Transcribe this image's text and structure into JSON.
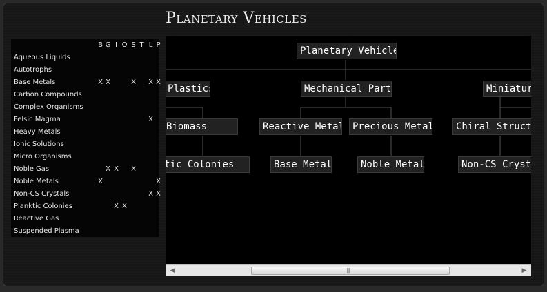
{
  "window": {
    "title": "Planetary Vehicles"
  },
  "matrix": {
    "header": [
      "B",
      "G",
      "I",
      "O",
      "S",
      "T",
      "L",
      "P"
    ],
    "rows": [
      {
        "label": "Aqueous Liquids",
        "cells": [
          "",
          "",
          "",
          "",
          "",
          "",
          "",
          ""
        ]
      },
      {
        "label": "Autotrophs",
        "cells": [
          "",
          "",
          "",
          "",
          "",
          "",
          "",
          ""
        ]
      },
      {
        "label": "Base Metals",
        "cells": [
          "X",
          "X",
          "",
          "",
          "X",
          "",
          "X",
          "X"
        ]
      },
      {
        "label": "Carbon Compounds",
        "cells": [
          "",
          "",
          "",
          "",
          "",
          "",
          "",
          ""
        ]
      },
      {
        "label": "Complex Organisms",
        "cells": [
          "",
          "",
          "",
          "",
          "",
          "",
          "",
          ""
        ]
      },
      {
        "label": "Felsic Magma",
        "cells": [
          "",
          "",
          "",
          "",
          "",
          "",
          "X",
          ""
        ]
      },
      {
        "label": "Heavy Metals",
        "cells": [
          "",
          "",
          "",
          "",
          "",
          "",
          "",
          ""
        ]
      },
      {
        "label": "Ionic Solutions",
        "cells": [
          "",
          "",
          "",
          "",
          "",
          "",
          "",
          ""
        ]
      },
      {
        "label": "Micro Organisms",
        "cells": [
          "",
          "",
          "",
          "",
          "",
          "",
          "",
          ""
        ]
      },
      {
        "label": "Noble Gas",
        "cells": [
          "",
          "X",
          "X",
          "",
          "X",
          "",
          "",
          ""
        ]
      },
      {
        "label": "Noble Metals",
        "cells": [
          "X",
          "",
          "",
          "",
          "",
          "",
          "",
          "X"
        ]
      },
      {
        "label": "Non-CS Crystals",
        "cells": [
          "",
          "",
          "",
          "",
          "",
          "",
          "X",
          "X"
        ]
      },
      {
        "label": "Planktic Colonies",
        "cells": [
          "",
          "",
          "X",
          "X",
          "",
          "",
          "",
          ""
        ]
      },
      {
        "label": "Reactive Gas",
        "cells": [
          "",
          "",
          "",
          "",
          "",
          "",
          "",
          ""
        ]
      },
      {
        "label": "Suspended Plasma",
        "cells": [
          "",
          "",
          "",
          "",
          "",
          "",
          "",
          ""
        ]
      }
    ]
  },
  "tree": {
    "nodes": {
      "root": "Planetary Vehicles",
      "plastics": "Plastics",
      "mechanical_parts": "Mechanical Parts",
      "miniature": "Miniature",
      "biomass": "Biomass",
      "reactive_metals": "Reactive Metals",
      "precious_metals": "Precious Metals",
      "chiral_structures": "Chiral Structures",
      "planktic_colonies": "Planktic Colonies",
      "base_metals": "Base Metals",
      "noble_metals": "Noble Metals",
      "non_cs_crystals": "Non-CS Crystals"
    }
  },
  "scrollbar": {
    "left_arrow_icon": "triangle-left-icon",
    "right_arrow_icon": "triangle-right-icon",
    "grip_icon": "grip-icon",
    "position_fraction": 0.27
  },
  "colors": {
    "node_bg": "#222222",
    "node_border": "#3a3a3a",
    "text": "#ffffff",
    "connector": "#505050"
  }
}
